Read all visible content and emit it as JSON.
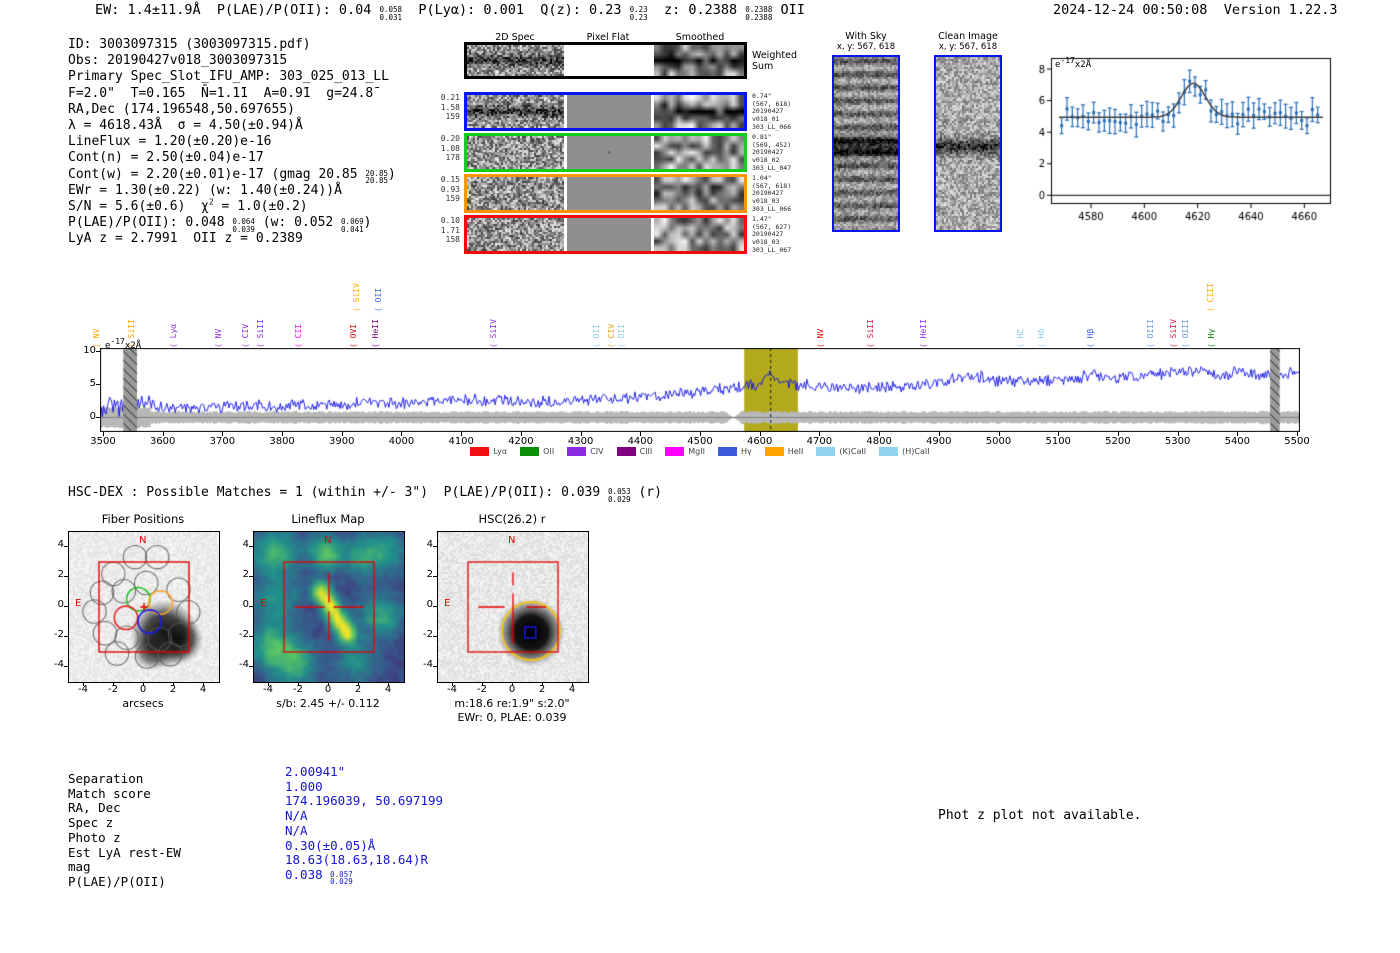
{
  "header": {
    "stats_tokens": [
      {
        "t": "EW: 1.4±11.9Å  P(LAE)/P(OII): 0.04 "
      },
      {
        "u": "0.058",
        "d": "0.031"
      },
      {
        "t": "  P(Lyα): 0.001  Q(z): 0.23 "
      },
      {
        "u": "0.23",
        "d": "0.23"
      },
      {
        "t": "  z: 0.2388 "
      },
      {
        "u": "0.2388",
        "d": "0.2388"
      },
      {
        "t": " OII"
      }
    ],
    "timestamp": "2024-12-24 00:50:08",
    "version": "Version 1.22.3"
  },
  "info_lines": [
    [
      {
        "t": "ID: 3003097315 (3003097315.pdf)"
      }
    ],
    [
      {
        "t": "Obs: 20190427v018_3003097315"
      }
    ],
    [
      {
        "t": "Primary Spec_Slot_IFU_AMP: 303_025_013_LL"
      }
    ],
    [
      {
        "t": "F=2.0\"  T=0.1̄65  N̄=1.1̄1  A=0.9̄1  g=24.8̄"
      }
    ],
    [
      {
        "t": "RA,Dec (174.196548,50.697655)"
      }
    ],
    [
      {
        "t": "λ = 4618.43Å  σ = 4.50(±0.94)Å"
      }
    ],
    [
      {
        "t": "LineFlux = 1.20(±0.20)e-16"
      }
    ],
    [
      {
        "t": "Cont(n) = 2.50(±0.04)e-17"
      }
    ],
    [
      {
        "t": "Cont(w) = 2.20(±0.01)e-17 (gmag 20.85 "
      },
      {
        "u": "20.85",
        "d": "20.85"
      },
      {
        "t": ")"
      }
    ],
    [
      {
        "t": "EWr = 1.30(±0.22) (w: 1.40(±0.24))Å"
      }
    ],
    [
      {
        "t": "S/N = 5.6(±0.6)  χ"
      },
      {
        "sup": "2"
      },
      {
        "t": " = 1.0(±0.2)"
      }
    ],
    [
      {
        "t": "P(LAE)/P(OII): 0.048 "
      },
      {
        "u": "0.064",
        "d": "0.039"
      },
      {
        "t": " (w: 0.052 "
      },
      {
        "u": "0.069",
        "d": "0.041"
      },
      {
        "t": ")"
      }
    ],
    [
      {
        "t": "LyA z = 2.7991  OII z = 0.2389"
      }
    ]
  ],
  "spec2d": {
    "col_headers": [
      "2D Spec",
      "Pixel Flat",
      "Smoothed"
    ],
    "rows": [
      {
        "color": "#000000",
        "left": [],
        "right": [
          "Weighted",
          "Sum"
        ],
        "big_right": true
      },
      {
        "color": "#0a16f1",
        "left": [
          "0.21",
          "1.58",
          "159"
        ],
        "right": [
          "0.74\"",
          "(567, 618)",
          "20190427",
          "v018_01",
          "303_LL_066"
        ]
      },
      {
        "color": "#12cf1c",
        "left": [
          "0.20",
          "1.08",
          "178"
        ],
        "right": [
          "0.81\"",
          "(569, 452)",
          "20190427",
          "v018_02",
          "303_LL_047"
        ]
      },
      {
        "color": "#ff9408",
        "left": [
          "0.15",
          "0.93",
          "159"
        ],
        "right": [
          "1.04\"",
          "(567, 618)",
          "20190427",
          "v018_03",
          "303_LL_066"
        ]
      },
      {
        "color": "#f10a0a",
        "left": [
          "0.10",
          "1.71",
          "158"
        ],
        "right": [
          "1.47\"",
          "(567, 627)",
          "20190427",
          "v018_03",
          "303_LL_067"
        ]
      }
    ]
  },
  "withsky": {
    "title": "With Sky",
    "coords": "x, y: 567, 618"
  },
  "clean": {
    "title": "Clean Image",
    "coords": "x, y: 567, 618"
  },
  "hscdex_tokens": [
    {
      "t": "HSC-DEX : Possible Matches = 1 (within +/- 3\")  P(LAE)/P(OII): 0.039 "
    },
    {
      "u": "0.053",
      "d": "0.029"
    },
    {
      "t": " (r)"
    }
  ],
  "cutouts": {
    "fiber": {
      "title": "Fiber Positions",
      "xlabel": "arcsecs",
      "ticks": [
        -4,
        -2,
        0,
        2,
        4
      ],
      "north": "N",
      "east": "E"
    },
    "lineflux": {
      "title": "Lineflux Map",
      "xlabel": "s/b: 2.45 +/- 0.112",
      "ticks": [
        -4,
        -2,
        0,
        2,
        4
      ],
      "north": "N",
      "east": "E"
    },
    "hsc": {
      "title": "HSC(26.2) r",
      "xlabel": "m:18.6  re:1.9\"  s:2.0\"",
      "xlabel2": "EWr: 0, PLAE: 0.039",
      "ticks": [
        -4,
        -2,
        0,
        2,
        4
      ],
      "north": "N",
      "east": "E"
    }
  },
  "match": {
    "rows": [
      {
        "label": "Separation",
        "value_tokens": [
          {
            "t": "2.00941\""
          }
        ]
      },
      {
        "label": "Match score",
        "value_tokens": [
          {
            "t": "1.000"
          }
        ]
      },
      {
        "label": "RA, Dec",
        "value_tokens": [
          {
            "t": "174.196039, 50.697199"
          }
        ]
      },
      {
        "label": "Spec z",
        "value_tokens": [
          {
            "t": "N/A"
          }
        ]
      },
      {
        "label": "Photo z",
        "value_tokens": [
          {
            "t": "N/A"
          }
        ]
      },
      {
        "label": "Est LyA rest-EW",
        "value_tokens": [
          {
            "t": "0.30(±0.05)Å"
          }
        ]
      },
      {
        "label": "mag",
        "value_tokens": [
          {
            "t": "18.63(18.63,18.64)R"
          }
        ]
      },
      {
        "label": "P(LAE)/P(OII)",
        "value_tokens": [
          {
            "t": "0.038 "
          },
          {
            "u": "0.057",
            "d": "0.029"
          }
        ]
      }
    ],
    "photz_note": "Phot z plot not available."
  },
  "chart_data": [
    {
      "id": "line-fit",
      "type": "scatter",
      "title": "emission line gaussian fit",
      "unit_label_tokens": [
        {
          "t": "e"
        },
        {
          "sup": "-17"
        },
        {
          "t": "x2Å"
        }
      ],
      "xlim": [
        4565,
        4670
      ],
      "ylim": [
        -0.55,
        8.7
      ],
      "x_ticks": [
        4580,
        4600,
        4620,
        4640,
        4660
      ],
      "y_ticks": [
        0,
        2,
        4,
        6,
        8
      ],
      "continuum": 4.95,
      "peak_amplitude": 2.15,
      "center": 4618.4,
      "sigma": 4.5,
      "point_step": 2,
      "avg_error": 0.65,
      "point_color": "#2a6db5",
      "fit_color": "#3d3d3d"
    },
    {
      "id": "full-spectrum",
      "type": "line",
      "unit_label_tokens": [
        {
          "t": "e"
        },
        {
          "sup": "-17"
        },
        {
          "t": "x2Å"
        }
      ],
      "xlim": [
        3495,
        5505
      ],
      "ylim": [
        -2.2,
        10.5
      ],
      "x_ticks": [
        3500,
        3600,
        3700,
        3800,
        3900,
        4000,
        4100,
        4200,
        4300,
        4400,
        4500,
        4600,
        4700,
        4800,
        4900,
        5000,
        5100,
        5200,
        5300,
        5400,
        5500
      ],
      "y_ticks": [
        0,
        5,
        10
      ],
      "line_color": "#0f0fe8",
      "error_band_color": "#b8b8b8",
      "highlight_band": {
        "x0": 4574,
        "x1": 4664,
        "color": "#b2aa1c"
      },
      "marker_wavelength": 4618.43,
      "masked_bands": [
        [
          3534,
          3557
        ],
        [
          5455,
          5471
        ]
      ],
      "continuum_anchors": [
        [
          3495,
          1.1
        ],
        [
          3510,
          1.6
        ],
        [
          3540,
          1.8
        ],
        [
          3570,
          1.9
        ],
        [
          3620,
          1.5
        ],
        [
          3680,
          1.6
        ],
        [
          3750,
          1.7
        ],
        [
          3820,
          1.8
        ],
        [
          3900,
          2.0
        ],
        [
          3980,
          2.2
        ],
        [
          4060,
          2.5
        ],
        [
          4140,
          2.6
        ],
        [
          4220,
          2.2
        ],
        [
          4300,
          2.6
        ],
        [
          4380,
          3.0
        ],
        [
          4460,
          3.5
        ],
        [
          4530,
          4.2
        ],
        [
          4575,
          4.7
        ],
        [
          4600,
          5.0
        ],
        [
          4618,
          6.9
        ],
        [
          4635,
          5.0
        ],
        [
          4660,
          4.8
        ],
        [
          4700,
          4.9
        ],
        [
          4740,
          4.4
        ],
        [
          4780,
          4.6
        ],
        [
          4820,
          4.7
        ],
        [
          4860,
          4.8
        ],
        [
          4900,
          5.3
        ],
        [
          4940,
          5.9
        ],
        [
          4970,
          6.2
        ],
        [
          5000,
          5.5
        ],
        [
          5030,
          5.3
        ],
        [
          5060,
          5.6
        ],
        [
          5090,
          5.4
        ],
        [
          5120,
          5.8
        ],
        [
          5160,
          6.3
        ],
        [
          5200,
          6.1
        ],
        [
          5240,
          6.4
        ],
        [
          5280,
          6.7
        ],
        [
          5320,
          6.9
        ],
        [
          5350,
          7.0
        ],
        [
          5375,
          6.1
        ],
        [
          5395,
          6.9
        ],
        [
          5420,
          6.4
        ],
        [
          5445,
          6.6
        ],
        [
          5460,
          6.2
        ],
        [
          5480,
          6.7
        ],
        [
          5505,
          6.9
        ]
      ],
      "emission_lines": [
        {
          "name": "NV",
          "wave": 3508,
          "color": "#ffa500",
          "tier": 0
        },
        {
          "name": "SiII",
          "wave": 3567,
          "color": "#ffa500",
          "tier": 0
        },
        {
          "name": "Lyα",
          "wave": 3637,
          "color": "#8a2be2",
          "tier": 0
        },
        {
          "name": "NV",
          "wave": 3713,
          "color": "#8a2be2",
          "tier": 0
        },
        {
          "name": "CIV",
          "wave": 3758,
          "color": "#8a2be2",
          "tier": 0
        },
        {
          "name": "SiII",
          "wave": 3783,
          "color": "#8a2be2",
          "tier": 0
        },
        {
          "name": "CII",
          "wave": 3847,
          "color": "#ff00ff",
          "tier": 0
        },
        {
          "name": "OVI",
          "wave": 3939,
          "color": "#e50000",
          "tier": 0
        },
        {
          "name": "SiIV",
          "wave": 3944,
          "color": "#ffa500",
          "tier": 1
        },
        {
          "name": "HeII",
          "wave": 3976,
          "color": "#800080",
          "tier": 0
        },
        {
          "name": "OII",
          "wave": 3981,
          "color": "#4169e1",
          "tier": 1
        },
        {
          "name": "SiIV",
          "wave": 4173,
          "color": "#8a2be2",
          "tier": 0
        },
        {
          "name": "OII",
          "wave": 4346,
          "color": "#87ceeb",
          "tier": 0
        },
        {
          "name": "CIV",
          "wave": 4371,
          "color": "#daa520",
          "tier": 0
        },
        {
          "name": "OII",
          "wave": 4388,
          "color": "#87ceeb",
          "tier": 0
        },
        {
          "name": "NV",
          "wave": 4721,
          "color": "#e50000",
          "tier": 0
        },
        {
          "name": "SiII",
          "wave": 4805,
          "color": "#dc143c",
          "tier": 0
        },
        {
          "name": "HeII",
          "wave": 4894,
          "color": "#8a2be2",
          "tier": 0
        },
        {
          "name": "Hζ",
          "wave": 5056,
          "color": "#87ceeb",
          "tier": 0
        },
        {
          "name": "Hδ",
          "wave": 5091,
          "color": "#87ceeb",
          "tier": 0
        },
        {
          "name": "Hβ",
          "wave": 5173,
          "color": "#4169e1",
          "tier": 0
        },
        {
          "name": "OIII",
          "wave": 5274,
          "color": "#6495ed",
          "tier": 0
        },
        {
          "name": "SiIV",
          "wave": 5312,
          "color": "#dc143c",
          "tier": 0
        },
        {
          "name": "OIII",
          "wave": 5332,
          "color": "#6495ed",
          "tier": 0
        },
        {
          "name": "Hγ",
          "wave": 5376,
          "color": "#008000",
          "tier": 0
        },
        {
          "name": "CIII",
          "wave": 5374,
          "color": "#ffa500",
          "tier": 1
        }
      ],
      "legend": [
        {
          "label": "Lyα",
          "color": "#f01010"
        },
        {
          "label": "OII",
          "color": "#0a8f0a"
        },
        {
          "label": "CIV",
          "color": "#8a2be2"
        },
        {
          "label": "CIII",
          "color": "#800080"
        },
        {
          "label": "MgII",
          "color": "#ff00ff"
        },
        {
          "label": "Hγ",
          "color": "#3b5bdb"
        },
        {
          "label": "HeII",
          "color": "#ffa500"
        },
        {
          "label": "(K)CaII",
          "color": "#8fd3ef"
        },
        {
          "label": "(H)CaII",
          "color": "#8fd3ef"
        }
      ]
    }
  ]
}
